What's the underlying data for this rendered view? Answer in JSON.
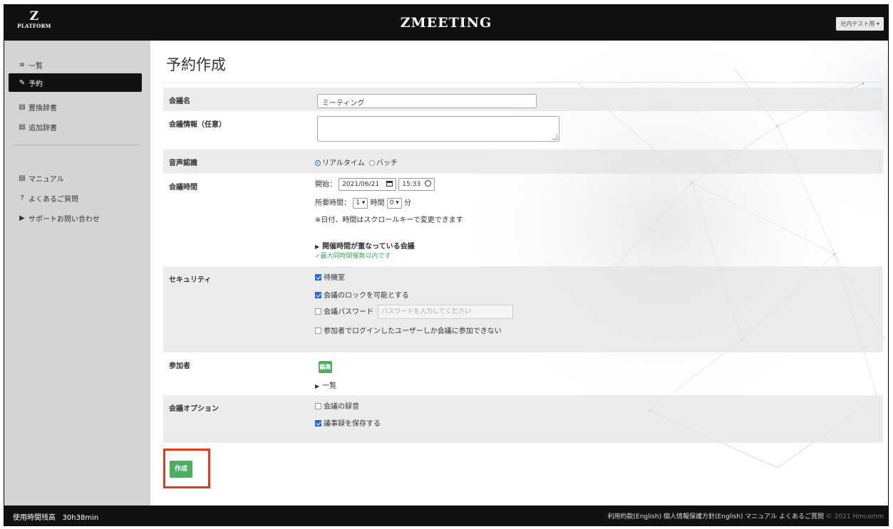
{
  "header": {
    "logo_letter": "Z",
    "logo_sub": "PLATFORM",
    "app_title": "ZMEETING",
    "user_button": "社内テスト用 ▾"
  },
  "sidebar": {
    "items": [
      {
        "icon": "≡",
        "label": "一覧"
      },
      {
        "icon": "✎",
        "label": "予約"
      },
      {
        "icon": "▤",
        "label": "置換辞書"
      },
      {
        "icon": "▤",
        "label": "追加辞書"
      },
      {
        "icon": "▤",
        "label": "マニュアル"
      },
      {
        "icon": "?",
        "label": "よくあるご質問"
      },
      {
        "icon": "▶",
        "label": "サポートお問い合わせ"
      }
    ]
  },
  "main": {
    "page_title": "予約作成",
    "form": {
      "meeting_name_label": "会議名",
      "meeting_name_value": "ミーティング",
      "meeting_info_label": "会議情報（任意）",
      "speech_label": "音声認識",
      "speech_realtime": "リアルタイム",
      "speech_batch": "バッチ",
      "time_label": "会議時間",
      "start_label": "開始：",
      "start_date": "2021/06/21",
      "start_time": "15:33",
      "duration_label": "所要時間：",
      "duration_hours": "1",
      "hours_unit": "時間",
      "duration_minutes": "0",
      "minutes_unit": "分",
      "scroll_note": "※日付、時間はスクロールキーで変更できます",
      "overlap_toggle": "開催時間が重なっている会議",
      "overlap_status": "✓最大同時開催数以内です",
      "security_label": "セキュリティ",
      "waiting_room": "待機室",
      "lock_meeting": "会議のロックを可能とする",
      "meeting_password": "会議パスワード",
      "password_placeholder": "パスワードを入力してください",
      "login_only": "参加者でログインしたユーザーしか会議に参加できない",
      "participants_label": "参加者",
      "edit_button": "編集",
      "list_toggle": "一覧",
      "options_label": "会議オプション",
      "record_meeting": "会議の録音",
      "save_minutes": "議事録を保存する",
      "create_button": "作成"
    }
  },
  "footer": {
    "remaining_label": "使用時間残高",
    "remaining_value": "30h38min",
    "links": [
      "利用約款(English)",
      "個人情報保護方針(English)",
      "マニュアル",
      "よくあるご質問"
    ],
    "copyright": "© 2021 Hmcomm"
  }
}
